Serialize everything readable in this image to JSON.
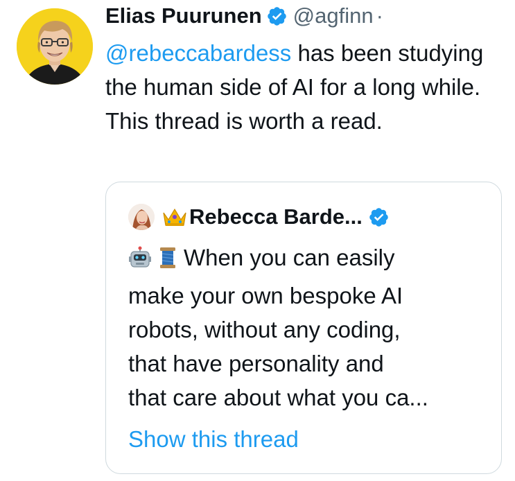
{
  "tweet": {
    "author_name": "Elias Puurunen",
    "handle": "@agfinn",
    "separator": "·",
    "mention": "@rebeccabardess",
    "text_rest": " has been studying the human side of AI for a long while. This thread is worth a read."
  },
  "quote": {
    "author_name": "Rebecca Barde...",
    "text_lines": [
      "When you can easily",
      "make your own bespoke AI",
      "robots, without any coding,",
      "that have personality and",
      "that care about what you ca..."
    ],
    "show_thread_label": "Show this thread"
  },
  "colors": {
    "accent": "#1d9bf0",
    "text": "#0f1419",
    "secondary": "#536471",
    "border": "#cfd9de",
    "avatar_bg": "#f5d21c"
  },
  "icons": {
    "verified": "verified-badge-icon",
    "robot": "robot-emoji-icon",
    "spool": "spool-emoji-icon",
    "crown": "crown-emoji-icon"
  }
}
